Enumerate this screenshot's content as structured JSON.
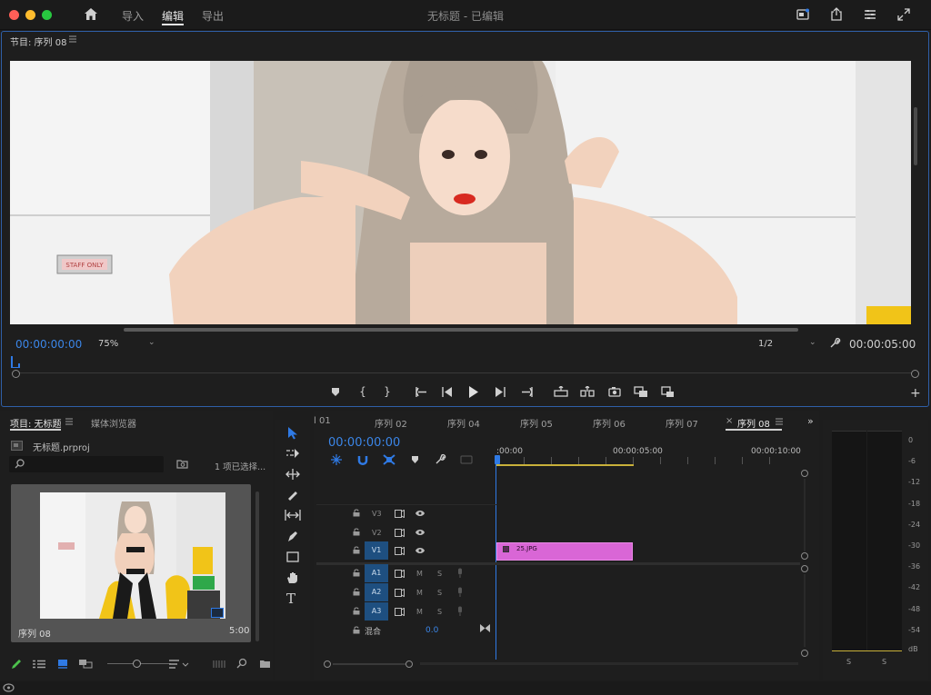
{
  "window": {
    "title": "无标题 - 已编辑",
    "nav": {
      "import": "导入",
      "edit": "编辑",
      "export": "导出"
    }
  },
  "program_monitor": {
    "title": "节目: 序列 08",
    "current_tc": "00:00:00:00",
    "zoom": "75%",
    "resolution": "1/2",
    "duration_tc": "00:00:05:00",
    "video_sign_text": "STAFF ONLY"
  },
  "project_panel": {
    "tab_project": "项目: 无标题",
    "tab_media": "媒体浏览器",
    "file_name": "无标题.prproj",
    "selected_count": "1 项已选择...",
    "item_name": "序列 08",
    "item_duration": "5:00"
  },
  "timeline": {
    "tabs": [
      "l 01",
      "序列 02",
      "序列 04",
      "序列 05",
      "序列 06",
      "序列 07",
      "序列 08"
    ],
    "active_tab": "序列 08",
    "current_tc": "00:00:00:00",
    "ruler": [
      ":00:00",
      "00:00:05:00",
      "00:00:10:00"
    ],
    "video_tracks": [
      {
        "name": "V3"
      },
      {
        "name": "V2"
      },
      {
        "name": "V1",
        "target": "V1"
      }
    ],
    "audio_tracks": [
      {
        "name": "A1",
        "target": "A1"
      },
      {
        "name": "A2",
        "target": "A2"
      },
      {
        "name": "A3",
        "target": "A3"
      }
    ],
    "mix_label": "混合",
    "mix_value": "0.0",
    "clip_name": "25.JPG",
    "m_label": "M",
    "s_label": "S"
  },
  "audio_meter": {
    "scale": [
      "0",
      "-6",
      "-12",
      "-18",
      "-24",
      "-30",
      "-36",
      "-42",
      "-48",
      "-54",
      "dB"
    ],
    "solo_left": "S",
    "solo_right": "S"
  },
  "colors": {
    "accent": "#2f7ae5",
    "clip": "#d966d6",
    "target": "#1e4f80",
    "work_area": "#c9b13a"
  }
}
